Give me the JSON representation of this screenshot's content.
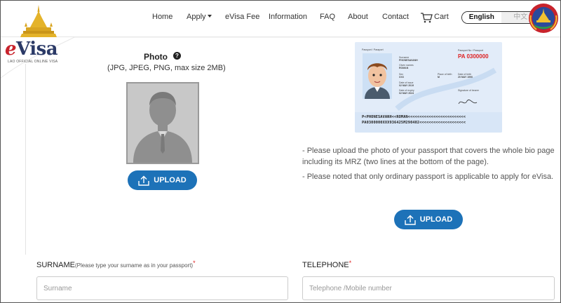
{
  "brand": {
    "logo_text_e": "e",
    "logo_text_rest": "Visa",
    "logo_subtitle": "LAO OFFICIAL ONLINE VISA"
  },
  "nav": {
    "items": [
      "Home",
      "Apply",
      "eVisa Fee",
      "Information",
      "FAQ",
      "About",
      "Contact"
    ],
    "cart_label": "Cart",
    "lang_active": "English",
    "lang_inactive": "中文"
  },
  "photo": {
    "title": "Photo",
    "help_glyph": "?",
    "note": "(JPG, JPEG, PNG, max size 2MB)",
    "upload_label": "UPLOAD"
  },
  "passport": {
    "header_left": "Passport / Passport",
    "header_right": "Passport No / Passport",
    "number": "PA 0300000",
    "fields": [
      {
        "label": "Surname",
        "value": "PHONESAVANH"
      },
      {
        "label": "Given names",
        "value": "ROMAN"
      },
      {
        "label": "Sex",
        "value": "XXX"
      },
      {
        "label": "Date of issue",
        "value": "02 MAY 2019"
      },
      {
        "label": "Date of expiry",
        "value": "02 MAY 2024"
      }
    ],
    "side_fields": [
      {
        "label": "Place of birth",
        "value": "M"
      },
      {
        "label": "Date of birth",
        "value": "20 MAY 1990"
      },
      {
        "label": "Signature of bearer",
        "value": ""
      }
    ],
    "mrz_line1": "P<PHONESAVANH<<ROMAN<<<<<<<<<<<<<<<<<<<<<<<<<",
    "mrz_line2": "PA0300000XXX936425M290402<<<<<<<<<<<<<<<<<<<<"
  },
  "instructions": {
    "line1": "- Please upload the photo of your passport that covers the whole bio page including its MRZ (two lines at the bottom of the page).",
    "line2": "- Please noted that only ordinary passport is applicable to apply for eVisa.",
    "upload_label": "UPLOAD"
  },
  "form": {
    "surname_label": "SURNAME",
    "surname_hint": "(Please type your surname as in your passport)",
    "surname_placeholder": "Surname",
    "telephone_label": "TELEPHONE",
    "telephone_placeholder": "Telephone /Mobile number",
    "required_mark": "*"
  },
  "colors": {
    "primary_button": "#1d72b8",
    "required": "#dd2222",
    "passport_number": "#dd2222"
  },
  "icons": {
    "upload": "upload-icon",
    "cart": "cart-icon",
    "help": "help-icon",
    "emblem": "lao-emblem-icon",
    "logo": "that-luang-stupa-icon"
  }
}
